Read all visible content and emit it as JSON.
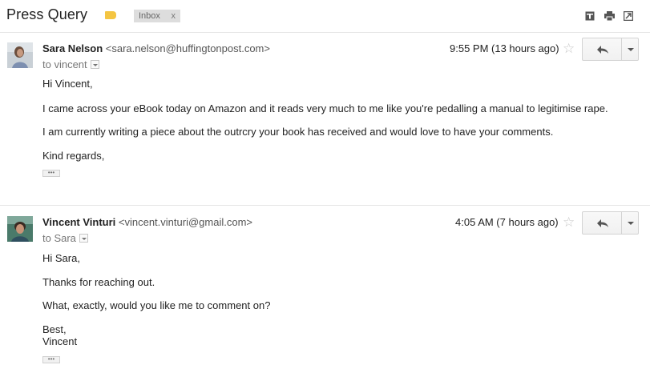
{
  "thread": {
    "subject": "Press Query",
    "label_chip": "Inbox",
    "label_chip_close": "x",
    "label_color": "#f4c542"
  },
  "header_icons": [
    "archive-icon",
    "print-icon",
    "open-new-window-icon"
  ],
  "messages": [
    {
      "sender_name": "Sara Nelson",
      "sender_email": "<sara.nelson@huffingtonpost.com>",
      "to": "to vincent",
      "time": "9:55 PM (13 hours ago)",
      "lines": [
        "Hi Vincent,",
        "I came across your eBook today on Amazon and it reads very much to me like you're pedalling a manual to legitimise rape.",
        "I am currently writing a piece about the outrcry your book has received and would love to have your comments.",
        "Kind regards,"
      ]
    },
    {
      "sender_name": "Vincent Vinturi",
      "sender_email": "<vincent.vinturi@gmail.com>",
      "to": "to Sara",
      "time": "4:05 AM (7 hours ago)",
      "lines": [
        "Hi Sara,",
        "Thanks for reaching out.",
        "What, exactly, would you like me to comment on?",
        "Best,",
        "Vincent"
      ]
    }
  ],
  "ellipsis_label": "•••"
}
